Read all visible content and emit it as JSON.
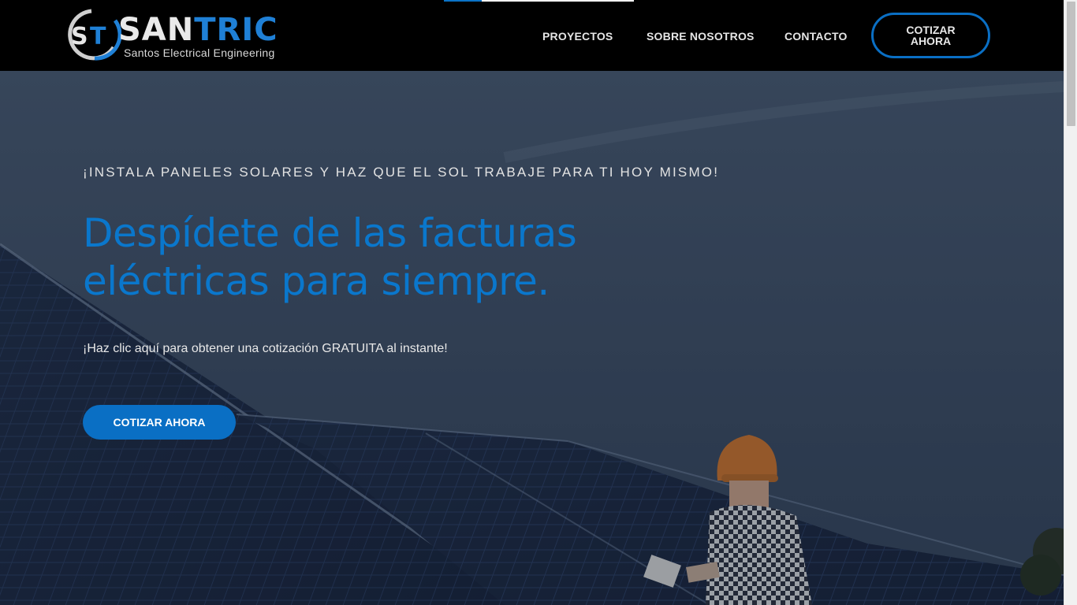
{
  "colors": {
    "brand_blue": "#0a6fc4",
    "headline_blue": "#0a77cc",
    "header_bg": "#000000",
    "text_light": "#e8e8e8"
  },
  "header": {
    "logo": {
      "mark": "ST",
      "name_part1": "SAN",
      "name_part2": "TRIC",
      "tagline": "Santos Electrical Engineering"
    },
    "nav": {
      "proyectos": "PROYECTOS",
      "sobre_nosotros": "SOBRE NOSOTROS",
      "contacto": "CONTACTO"
    },
    "cta_label": "COTIZAR AHORA"
  },
  "hero": {
    "eyebrow": "¡INSTALA PANELES SOLARES Y HAZ QUE EL SOL TRABAJE PARA TI HOY MISMO!",
    "headline": "Despídete de las facturas eléctricas para siempre.",
    "subtext": "¡Haz clic aquí para obtener una cotización GRATUITA al instante!",
    "cta_label": "COTIZAR AHORA",
    "background_icon": "solar-panels-worker-photo"
  }
}
